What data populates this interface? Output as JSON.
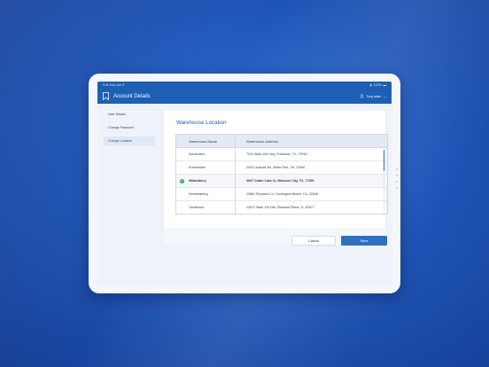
{
  "statusbar": {
    "time": "9:41 Mon Jun 3",
    "battery": "100%"
  },
  "appbar": {
    "title": "Account Details",
    "user": "Tony stark",
    "logo_icon": "bookmark-logo-icon",
    "user_icon": "user-icon"
  },
  "sidebar": {
    "items": [
      {
        "label": "User Details"
      },
      {
        "label": "Change Password"
      },
      {
        "label": "Change Location"
      }
    ]
  },
  "panel": {
    "title": "Warehouse Location",
    "columns": [
      "Warehouse Name",
      "Warehouse Address"
    ],
    "rows": [
      {
        "name": "Samarafort",
        "address": "7910 State 155 Hwy, Frankston, TX, 75763"
      },
      {
        "name": "Robertsville",
        "address": "2403 Leafcale Rd, White Pine, TN, 37890"
      },
      {
        "name": "Willardbury",
        "address": "3007 Cotter Lake Cr, Missouri City, TX, 77459"
      },
      {
        "name": "Demetrisberg",
        "address": "19581 Pompano Ln, Huntington Beach, CA, 92648"
      },
      {
        "name": "Yoshikoton",
        "address": "13317 State 125 Rte, Pleasant Plains, IL, 62677"
      }
    ],
    "selected_index": 2
  },
  "actions": {
    "cancel_label": "Cancel",
    "save_label": "Save"
  },
  "colors": {
    "accent": "#1d5fb4",
    "selected_check": "#33a852"
  }
}
